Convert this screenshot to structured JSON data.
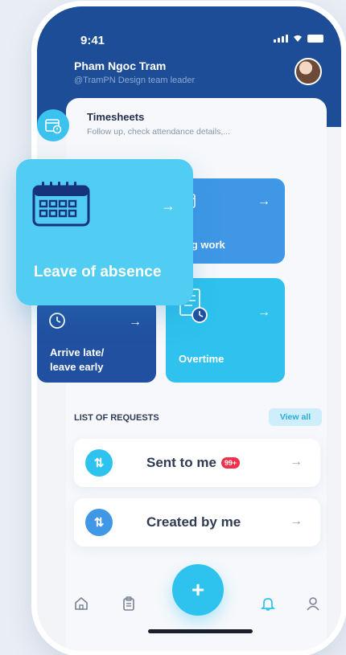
{
  "status": {
    "time": "9:41"
  },
  "user": {
    "name": "Pham Ngoc Tram",
    "subtitle": "@TramPN  Design team leader"
  },
  "timesheets": {
    "title": "Timesheets",
    "subtitle": "Follow up, check attendance details,..."
  },
  "tiles": {
    "leave": {
      "label": "Leave of absence",
      "arrow": "→"
    },
    "log_work": {
      "label": "Log work",
      "arrow": "→"
    },
    "arrive_late": {
      "label_line1": "Arrive late/",
      "label_line2": "leave early",
      "arrow": "→"
    },
    "overtime": {
      "label": "Overtime",
      "arrow": "→"
    }
  },
  "requests": {
    "header": "LIST OF REQUESTS",
    "view_all": "View all",
    "items": [
      {
        "label": "Sent to me",
        "badge": "99+",
        "arrow": "→",
        "icon": "swap-icon",
        "icon_color": "#2ec3ef"
      },
      {
        "label": "Created by me",
        "arrow": "→",
        "icon": "swap-icon",
        "icon_color": "#3f97e6"
      }
    ]
  },
  "nav": {
    "fab": "+",
    "icons": [
      "home-icon",
      "clipboard-icon",
      "bell-icon",
      "profile-icon"
    ],
    "active": "bell-icon"
  },
  "colors": {
    "header": "#1c4d96",
    "accent": "#2ec3ef",
    "badge": "#f1304b"
  }
}
